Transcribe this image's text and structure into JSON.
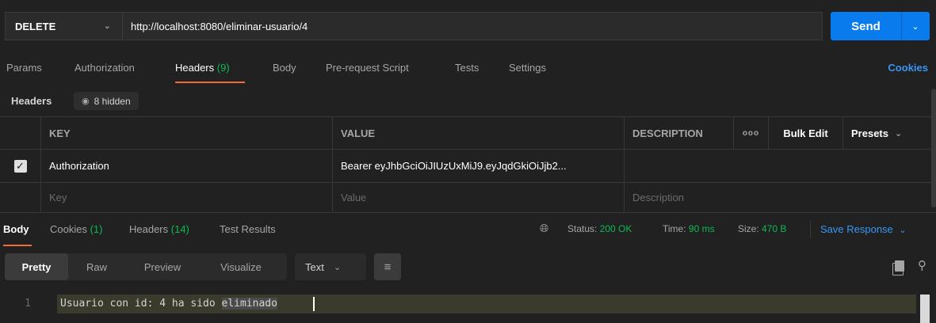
{
  "request": {
    "method": "DELETE",
    "url": "http://localhost:8080/eliminar-usuario/4",
    "send_label": "Send"
  },
  "request_tabs": [
    {
      "label": "Params"
    },
    {
      "label": "Authorization"
    },
    {
      "label": "Headers",
      "count": "(9)"
    },
    {
      "label": "Body"
    },
    {
      "label": "Pre-request Script"
    },
    {
      "label": "Tests"
    },
    {
      "label": "Settings"
    }
  ],
  "cookies_link": "Cookies",
  "headers_section": {
    "label": "Headers",
    "hidden_label": "8 hidden"
  },
  "headers_table": {
    "columns": {
      "key": "KEY",
      "value": "VALUE",
      "description": "DESCRIPTION",
      "more": "ooo",
      "bulk_edit": "Bulk Edit",
      "presets": "Presets"
    },
    "rows": [
      {
        "checked": true,
        "key": "Authorization",
        "value": "Bearer eyJhbGciOiJIUzUxMiJ9.eyJqdGkiOiJjb2...",
        "description": ""
      }
    ],
    "placeholders": {
      "key": "Key",
      "value": "Value",
      "description": "Description"
    }
  },
  "response_tabs": [
    {
      "label": "Body"
    },
    {
      "label": "Cookies",
      "count": "(1)"
    },
    {
      "label": "Headers",
      "count": "(14)"
    },
    {
      "label": "Test Results"
    }
  ],
  "response_status": {
    "status_label": "Status:",
    "status_value": "200 OK",
    "time_label": "Time:",
    "time_value": "90 ms",
    "size_label": "Size:",
    "size_value": "470 B",
    "save_response": "Save Response"
  },
  "response_toolbar": {
    "views": [
      "Pretty",
      "Raw",
      "Preview",
      "Visualize"
    ],
    "format": "Text"
  },
  "response_body": {
    "line_number": "1",
    "text_before": "Usuario con id: 4 ha sido ",
    "text_selected": "eliminado"
  }
}
